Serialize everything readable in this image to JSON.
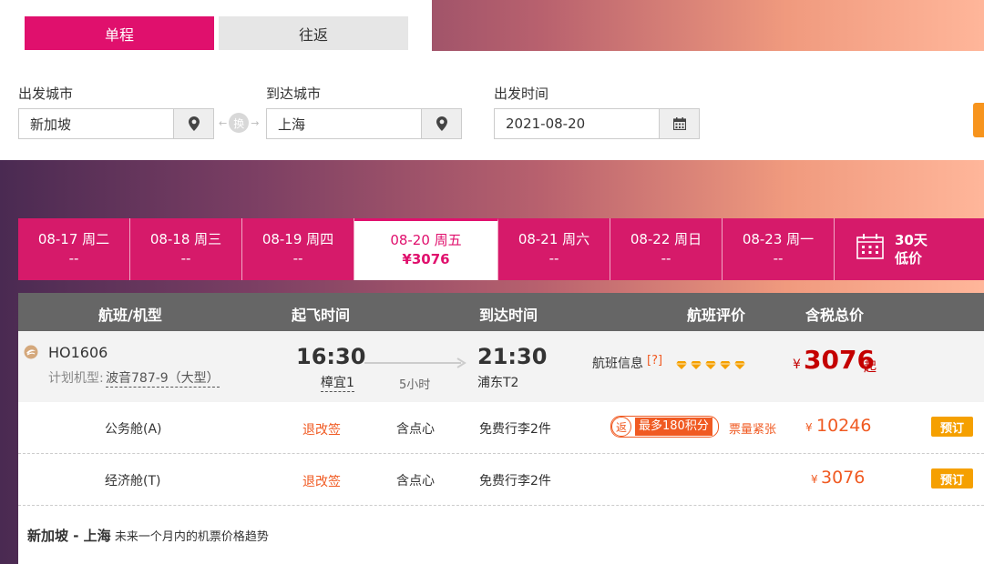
{
  "trip_type": {
    "one_way": "单程",
    "round_trip": "往返"
  },
  "search": {
    "from_label": "出发城市",
    "from_value": "新加坡",
    "swap_label": "换",
    "to_label": "到达城市",
    "to_value": "上海",
    "date_label": "出发时间",
    "date_value": "2021-08-20"
  },
  "date_tabs": [
    {
      "date": "08-17 周二",
      "price": "--"
    },
    {
      "date": "08-18 周三",
      "price": "--"
    },
    {
      "date": "08-19 周四",
      "price": "--"
    },
    {
      "date": "08-20 周五",
      "price": "¥3076"
    },
    {
      "date": "08-21 周六",
      "price": "--"
    },
    {
      "date": "08-22 周日",
      "price": "--"
    },
    {
      "date": "08-23 周一",
      "price": "--"
    }
  ],
  "calendar_tab": {
    "line1": "30天",
    "line2": "低价"
  },
  "table_headers": {
    "flight": "航班/机型",
    "depart": "起飞时间",
    "arrive": "到达时间",
    "rating": "航班评价",
    "price": "含税总价"
  },
  "flight": {
    "number": "HO1606",
    "aircraft_label": "计划机型:",
    "aircraft": "波音787-9（大型）",
    "depart_time": "16:30",
    "depart_airport": "樟宜1",
    "duration": "5小时",
    "arrive_time": "21:30",
    "arrive_airport": "浦东T2",
    "info_label": "航班信息",
    "info_help": "[?]",
    "rating_diamonds": 5,
    "currency": "¥",
    "price": "3076",
    "price_suffix": "起"
  },
  "cabins": [
    {
      "name": "公务舱(A)",
      "change": "退改签",
      "meal": "含点心",
      "baggage": "免费行李2件",
      "promo_icon": "返",
      "promo": "最多180积分",
      "status": "票量紧张",
      "currency": "¥",
      "price": "10246",
      "book": "预订"
    },
    {
      "name": "经济舱(T)",
      "change": "退改签",
      "meal": "含点心",
      "baggage": "免费行李2件",
      "currency": "¥",
      "price": "3076",
      "book": "预订"
    }
  ],
  "trend": {
    "route": "新加坡 - 上海",
    "desc": "未来一个月内的机票价格趋势"
  },
  "colors": {
    "brand": "#e0106d",
    "orange": "#f05a22",
    "book": "#f5a000"
  }
}
